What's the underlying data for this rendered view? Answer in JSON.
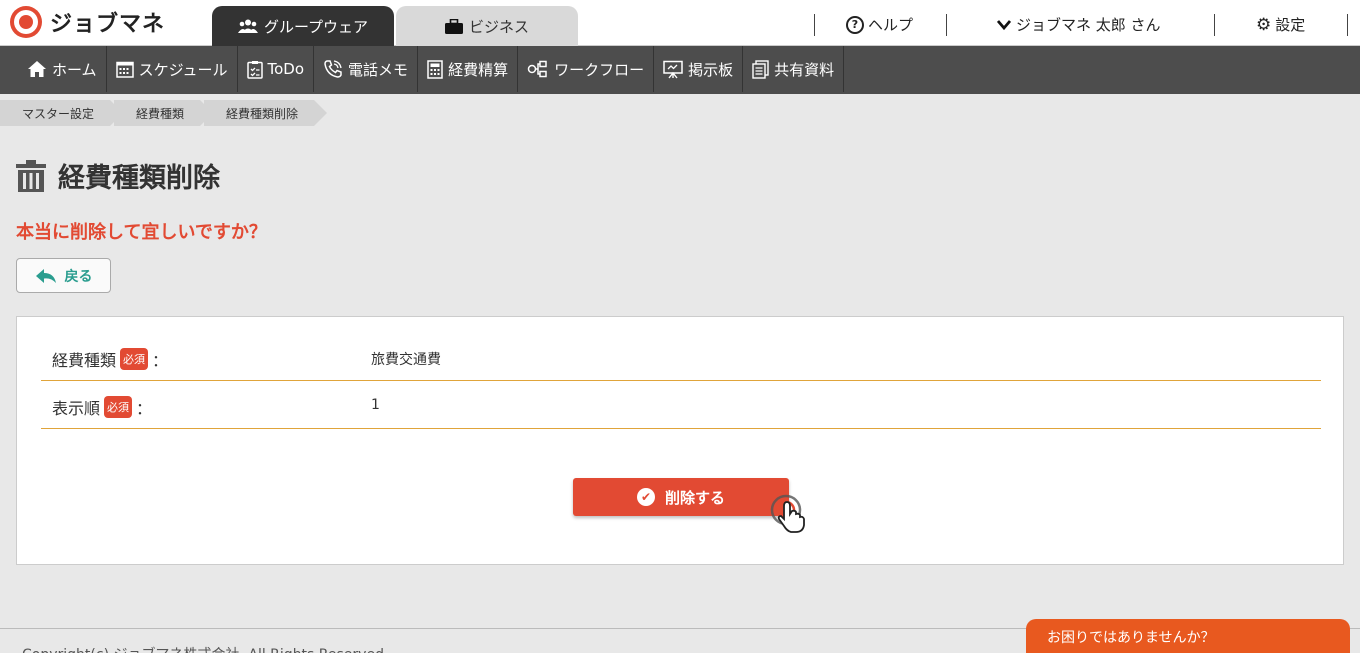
{
  "header": {
    "logo_text": "ジョブマネ",
    "app_tabs": [
      {
        "label": "グループウェア",
        "icon": "group-icon"
      },
      {
        "label": "ビジネス",
        "icon": "briefcase-icon"
      }
    ],
    "help_label": "ヘルプ",
    "user_label": "ジョブマネ 太郎 さん",
    "settings_label": "設定"
  },
  "nav": {
    "items": [
      {
        "label": "ホーム",
        "icon": "home-icon"
      },
      {
        "label": "スケジュール",
        "icon": "calendar-icon"
      },
      {
        "label": "ToDo",
        "icon": "checklist-icon"
      },
      {
        "label": "電話メモ",
        "icon": "phone-icon"
      },
      {
        "label": "経費精算",
        "icon": "calculator-icon"
      },
      {
        "label": "ワークフロー",
        "icon": "workflow-icon"
      },
      {
        "label": "掲示板",
        "icon": "board-icon"
      },
      {
        "label": "共有資料",
        "icon": "document-icon"
      }
    ]
  },
  "breadcrumb": [
    "マスター設定",
    "経費種類",
    "経費種類削除"
  ],
  "page": {
    "title": "経費種類削除",
    "confirm_message": "本当に削除して宜しいですか？",
    "back_label": "戻る"
  },
  "form": {
    "required_badge": "必須",
    "separator": "：",
    "rows": [
      {
        "label": "経費種類",
        "value": "旅費交通費"
      },
      {
        "label": "表示順",
        "value": "1"
      }
    ],
    "delete_label": "削除する"
  },
  "footer": {
    "copyright": "Copyright(c) ジョブマネ株式会社. All Rights Reserved.",
    "help_prompt": "お困りではありませんか？"
  },
  "colors": {
    "accent": "#e24a33",
    "nav_bg": "#4d4d4d",
    "help_bg": "#e8591f",
    "back_text": "#2a9d8f"
  }
}
